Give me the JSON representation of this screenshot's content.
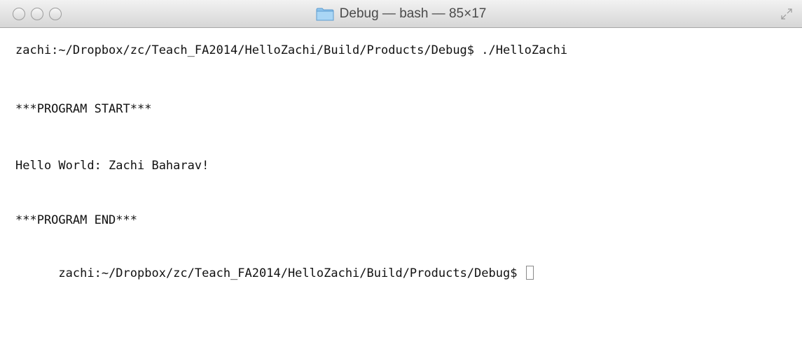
{
  "window": {
    "title": "Debug — bash — 85×17"
  },
  "icons": {
    "folder": "folder-icon",
    "fullscreen": "fullscreen-icon"
  },
  "terminal": {
    "lines": [
      "zachi:~/Dropbox/zc/Teach_FA2014/HelloZachi/Build/Products/Debug$ ./HelloZachi",
      "***PROGRAM START***",
      "Hello World: Zachi Baharav!",
      "***PROGRAM END***",
      "zachi:~/Dropbox/zc/Teach_FA2014/HelloZachi/Build/Products/Debug$ "
    ]
  },
  "colors": {
    "background": "#ffffff",
    "text": "#111111",
    "titlebar_top": "#f2f2f2",
    "titlebar_bottom": "#d6d6d6"
  }
}
